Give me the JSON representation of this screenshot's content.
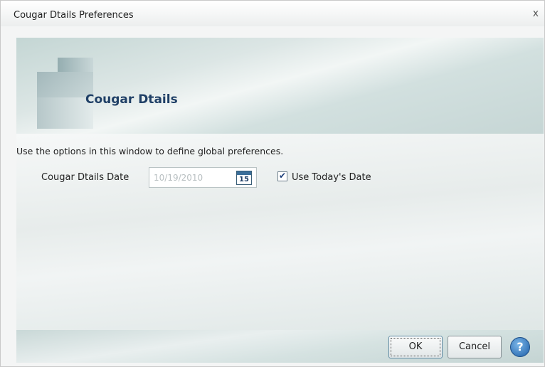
{
  "window": {
    "title": "Cougar Dtails Preferences",
    "close_symbol": "x"
  },
  "header": {
    "app_name": "Cougar Dtails",
    "logo_icon": "stacked-blocks-logo"
  },
  "content": {
    "description": "Use the options in this window to define global preferences.",
    "date_label": "Cougar Dtails Date",
    "date_value": "10/19/2010",
    "calendar_icon": "calendar-icon",
    "calendar_day": "15",
    "use_today_checked": true,
    "use_today_label": "Use Today's Date"
  },
  "footer": {
    "ok_label": "OK",
    "cancel_label": "Cancel",
    "help_symbol": "?"
  },
  "colors": {
    "accent": "#1f3f66",
    "help_blue": "#1f5fa8"
  }
}
